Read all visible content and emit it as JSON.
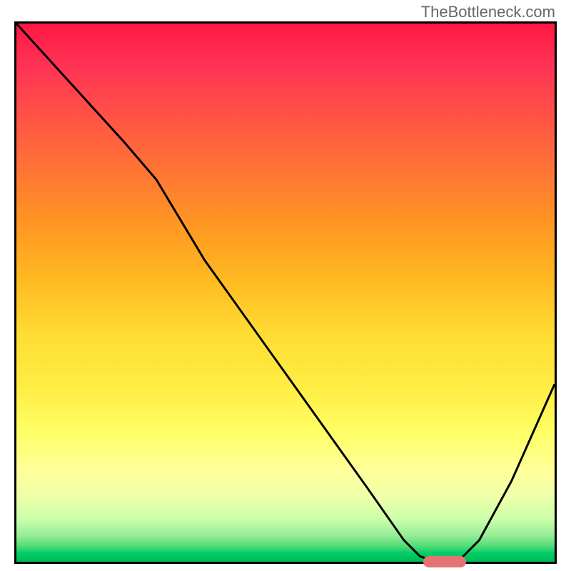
{
  "watermark": "TheBottleneck.com",
  "chart_data": {
    "type": "line",
    "title": "",
    "xlabel": "",
    "ylabel": "",
    "xlim": [
      0,
      100
    ],
    "ylim": [
      0,
      100
    ],
    "series": [
      {
        "name": "bottleneck-curve",
        "x": [
          0,
          10,
          20,
          26,
          35,
          45,
          55,
          65,
          72,
          75,
          78,
          82,
          86,
          92,
          100
        ],
        "y": [
          100,
          89,
          78,
          71,
          56,
          42,
          28,
          14,
          4,
          1,
          0,
          0,
          4,
          15,
          33
        ]
      }
    ],
    "optimal_marker": {
      "x_center": 79,
      "y": 0.5,
      "color": "#e57373"
    },
    "gradient_stops": [
      {
        "pos": 0,
        "color": "#ff1744"
      },
      {
        "pos": 50,
        "color": "#ffcc33"
      },
      {
        "pos": 80,
        "color": "#ffff77"
      },
      {
        "pos": 100,
        "color": "#00bb55"
      }
    ]
  }
}
